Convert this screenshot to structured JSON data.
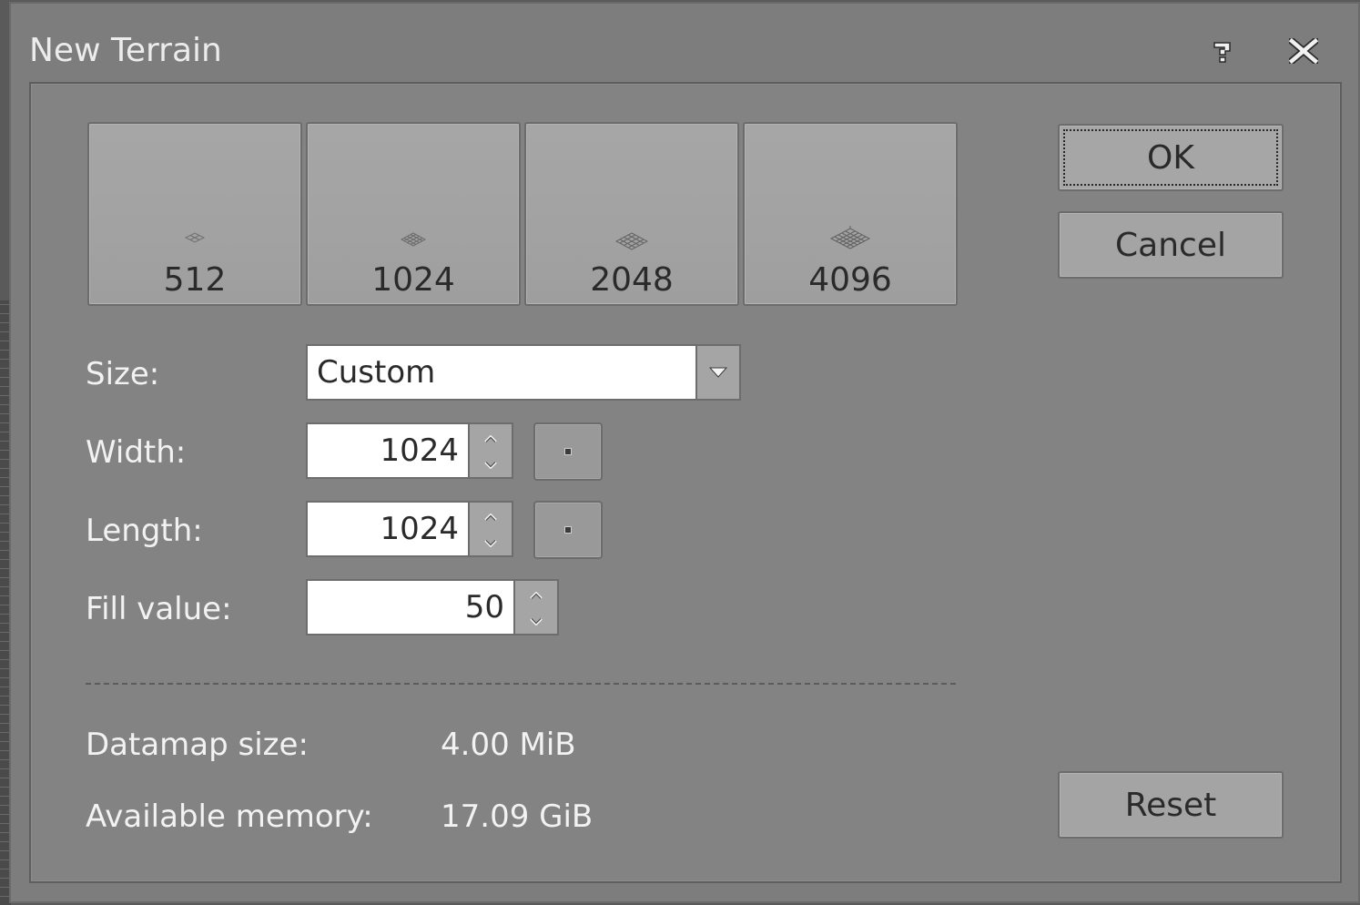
{
  "window": {
    "title": "New Terrain",
    "help_icon": "help-icon",
    "close_icon": "close-icon"
  },
  "presets": [
    {
      "label": "512",
      "icon": "terrain-grid-icon"
    },
    {
      "label": "1024",
      "icon": "terrain-grid-icon"
    },
    {
      "label": "2048",
      "icon": "terrain-grid-icon"
    },
    {
      "label": "4096",
      "icon": "terrain-grid-icon"
    }
  ],
  "form": {
    "size": {
      "label": "Size:",
      "value": "Custom"
    },
    "width": {
      "label": "Width:",
      "value": "1024"
    },
    "length": {
      "label": "Length:",
      "value": "1024"
    },
    "fill": {
      "label": "Fill value:",
      "value": "50"
    }
  },
  "info": {
    "datamap_label": "Datamap size:",
    "datamap_value": "4.00 MiB",
    "memory_label": "Available memory:",
    "memory_value": "17.09 GiB"
  },
  "buttons": {
    "ok": "OK",
    "cancel": "Cancel",
    "reset": "Reset"
  },
  "colors": {
    "dialog_bg": "#838383",
    "input_bg": "#ffffff",
    "button_bg": "#a4a4a4",
    "label_text": "#f2f2f2"
  }
}
